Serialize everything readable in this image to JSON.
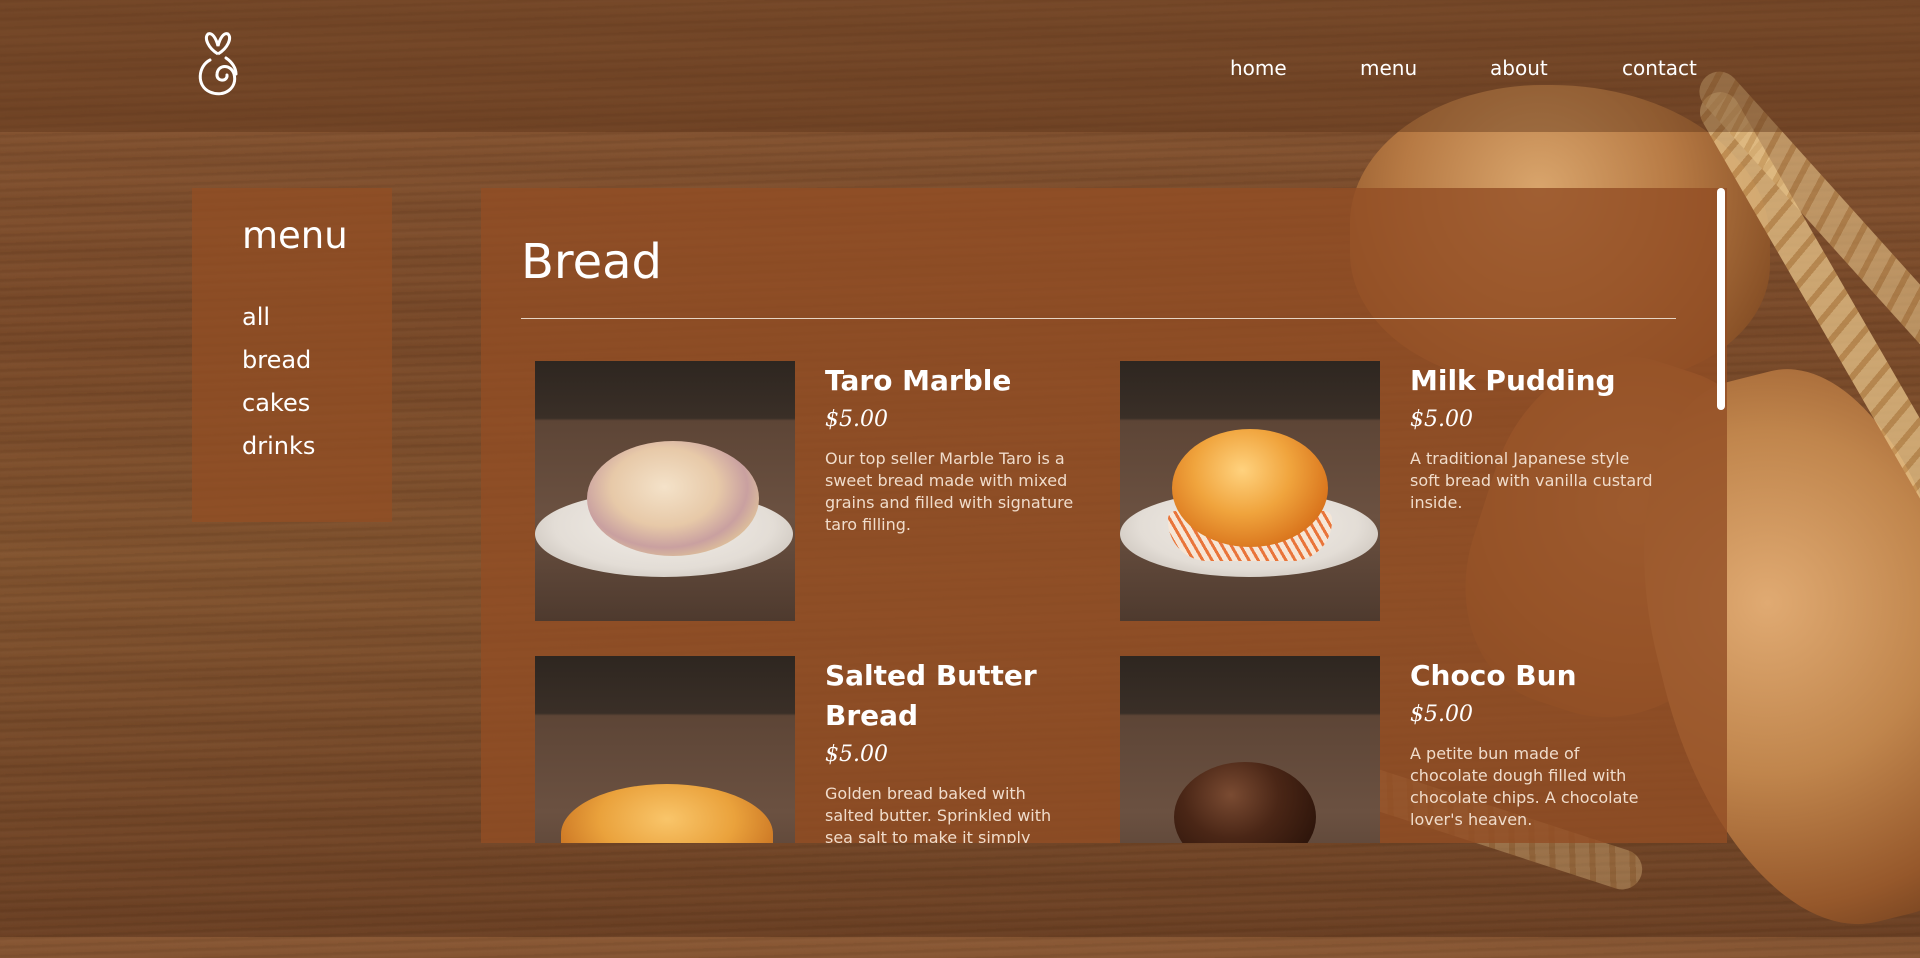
{
  "nav": {
    "home": "home",
    "menu": "menu",
    "about": "about",
    "contact": "contact"
  },
  "sidebar": {
    "title": "menu",
    "items": [
      {
        "label": "all"
      },
      {
        "label": "bread"
      },
      {
        "label": "cakes"
      },
      {
        "label": "drinks"
      }
    ]
  },
  "main": {
    "title": "Bread",
    "products": [
      {
        "name": "Taro Marble",
        "price": "$5.00",
        "description": "Our top seller Marble Taro is a sweet bread made with mixed grains and filled with signature taro filling."
      },
      {
        "name": "Milk Pudding",
        "price": "$5.00",
        "description": "A traditional Japanese style soft bread with vanilla custard inside."
      },
      {
        "name": "Salted Butter Bread",
        "price": "$5.00",
        "description": "Golden bread baked with salted butter. Sprinkled with sea salt to make it simply delicious."
      },
      {
        "name": "Choco Bun",
        "price": "$5.00",
        "description": "A petite bun made of chocolate dough filled with chocolate chips. A chocolate lover's heaven."
      }
    ]
  },
  "colors": {
    "panel": "#924e24",
    "text": "#ffffff"
  }
}
